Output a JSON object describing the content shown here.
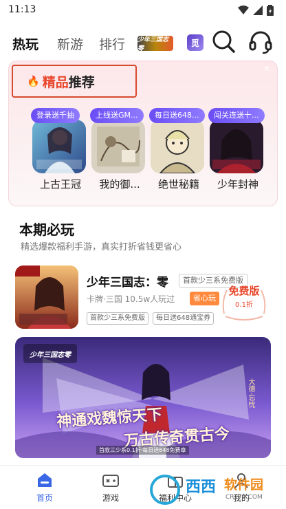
{
  "status": {
    "time": "11:13"
  },
  "topnav": {
    "tabs": [
      "热玩",
      "新游",
      "排行"
    ],
    "logo1_text": "少年三国志零",
    "logo2_text": "觅"
  },
  "recommend": {
    "title_red": "精品",
    "title_black": "推荐",
    "games": [
      {
        "tag": "登录送千抽",
        "name": "上古王冠"
      },
      {
        "tag": "上线送GM...",
        "name": "我的御..."
      },
      {
        "tag": "每日送648...",
        "name": "绝世秘籍"
      },
      {
        "tag": "闯关连送十...",
        "name": "少年封神"
      }
    ]
  },
  "section": {
    "title": "本期必玩",
    "subtitle": "精选爆款福利手游，真实打折省钱更省心"
  },
  "featured": {
    "name": "少年三国志：零",
    "name_tag": "首款少三系免费版",
    "meta": "卡牌·三国  10.5w人玩过",
    "badge": "省心玩",
    "free_title": "免费版",
    "free_sub": "0.1折",
    "tags": [
      "首款少三系免费版",
      "每日送648通宝券"
    ],
    "icon_text": "免费版"
  },
  "banner": {
    "line1": "神通戏魏惊天下",
    "line2": "万古传奇贯古今",
    "footnote": "首款三少系0.1折·每日送648免费章",
    "side_text": "大德·忘忧",
    "logo_text": "少年三国志零"
  },
  "bottom_nav": {
    "items": [
      "首页",
      "游戏",
      "福利中心",
      "我的"
    ]
  },
  "watermark": {
    "text1": "西西",
    "text2": "软件园",
    "url": "CR173.COM"
  },
  "colors": {
    "accent": "#3a67e6",
    "tag_purple": "#6a4df5",
    "title_red": "#e8462b",
    "badge_orange": "#ff8a3d"
  }
}
